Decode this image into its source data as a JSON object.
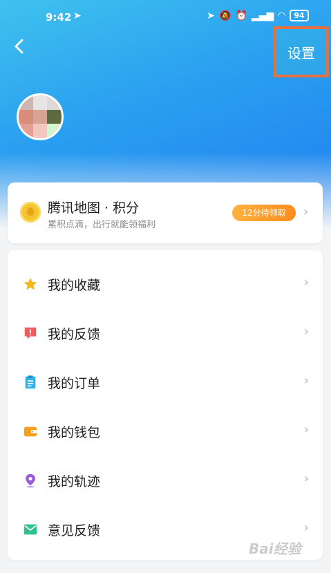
{
  "status_bar": {
    "time": "9:42",
    "battery": "94"
  },
  "header": {
    "back_glyph": "‹",
    "settings_label": "设置"
  },
  "points_card": {
    "title": "腾讯地图 · 积分",
    "subtitle": "累积点滴，出行就能领福利",
    "badge": "12分待领取",
    "chevron": "›"
  },
  "menu": {
    "items": [
      {
        "label": "我的收藏",
        "icon": "star-icon"
      },
      {
        "label": "我的反馈",
        "icon": "feedback-icon"
      },
      {
        "label": "我的订单",
        "icon": "clipboard-icon"
      },
      {
        "label": "我的钱包",
        "icon": "wallet-icon"
      },
      {
        "label": "我的轨迹",
        "icon": "location-pin-icon"
      },
      {
        "label": "意见反馈",
        "icon": "mail-icon"
      }
    ],
    "chevron": "›"
  },
  "watermark": "Bai经验",
  "colors": {
    "header_gradient_start": "#3ec2ee",
    "header_gradient_end": "#1f7ff0",
    "badge_orange": "#ff8c1f",
    "highlight_border": "#e8703e"
  }
}
